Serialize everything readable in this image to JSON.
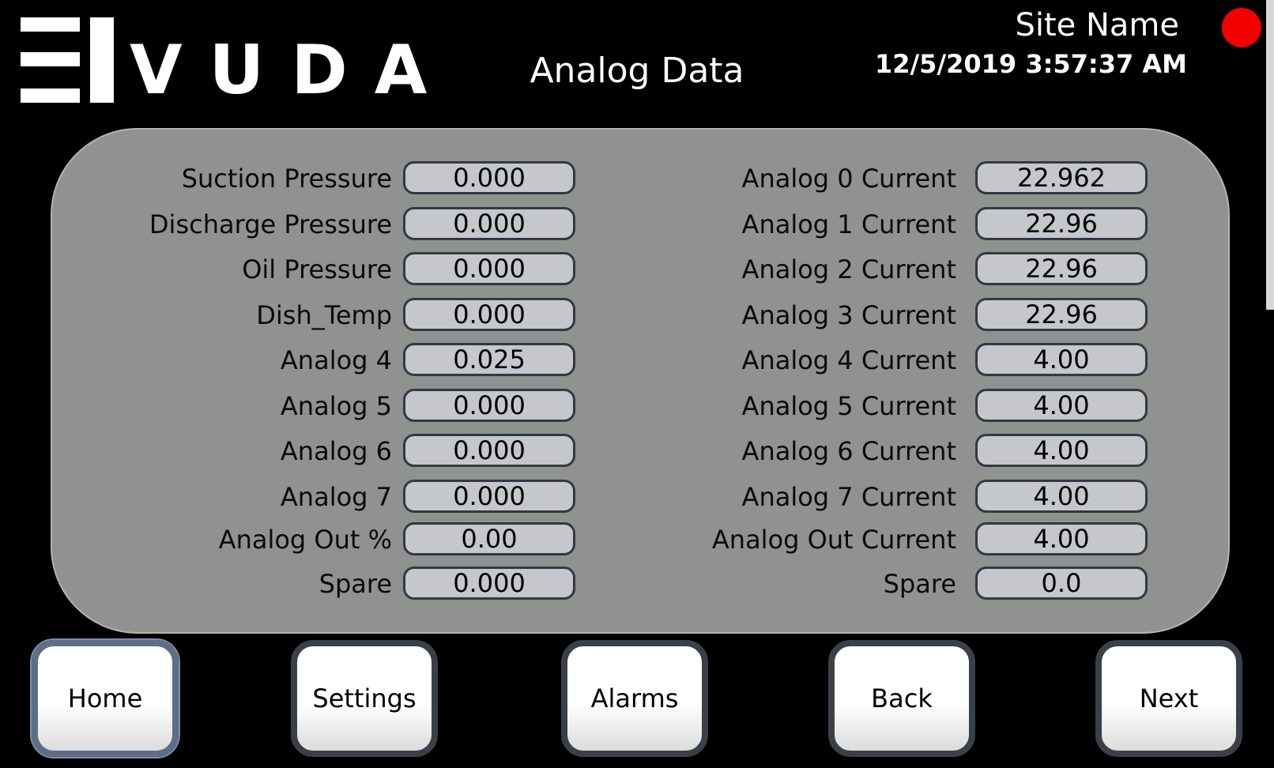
{
  "header": {
    "logo_text": "VUDA",
    "title": "Analog Data",
    "site_name": "Site Name",
    "datetime": "12/5/2019 3:57:37 AM",
    "status_color": "#f40000"
  },
  "left_rows": [
    {
      "label": "Suction Pressure",
      "value": "0.000"
    },
    {
      "label": "Discharge Pressure",
      "value": "0.000"
    },
    {
      "label": "Oil Pressure",
      "value": "0.000"
    },
    {
      "label": "Dish_Temp",
      "value": "0.000"
    },
    {
      "label": "Analog 4",
      "value": "0.025"
    },
    {
      "label": "Analog 5",
      "value": "0.000"
    },
    {
      "label": "Analog 6",
      "value": "0.000"
    },
    {
      "label": "Analog 7",
      "value": "0.000"
    },
    {
      "label": "Analog Out %",
      "value": "0.00"
    },
    {
      "label": "Spare",
      "value": "0.000"
    }
  ],
  "right_rows": [
    {
      "label": "Analog 0 Current",
      "value": "22.962"
    },
    {
      "label": "Analog 1 Current",
      "value": "22.96"
    },
    {
      "label": "Analog 2 Current",
      "value": "22.96"
    },
    {
      "label": "Analog 3 Current",
      "value": "22.96"
    },
    {
      "label": "Analog 4 Current",
      "value": "4.00"
    },
    {
      "label": "Analog 5 Current",
      "value": "4.00"
    },
    {
      "label": "Analog 6 Current",
      "value": "4.00"
    },
    {
      "label": "Analog 7 Current",
      "value": "4.00"
    },
    {
      "label": "Analog Out Current",
      "value": "4.00"
    },
    {
      "label": "Spare",
      "value": "0.0"
    }
  ],
  "nav": {
    "home": "Home",
    "settings": "Settings",
    "alarms": "Alarms",
    "back": "Back",
    "next": "Next"
  }
}
